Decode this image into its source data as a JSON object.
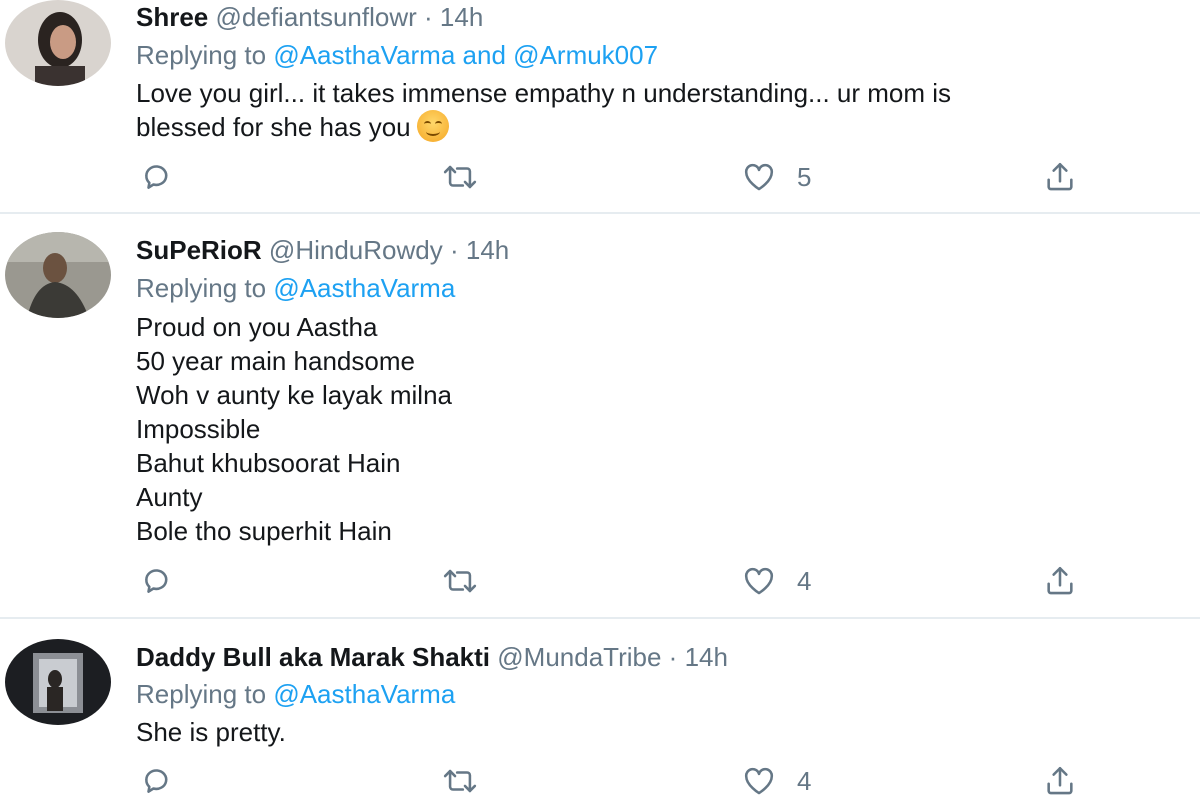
{
  "tweets": [
    {
      "name": "Shree",
      "handle": "@defiantsunflowr",
      "dot": "·",
      "time": "14h",
      "reply_prefix": "Replying to",
      "mention1": "@AasthaVarma",
      "and": "and",
      "mention2": "@Armuk007",
      "body": "Love you girl... it takes immense empathy n understanding... ur mom is\nblessed for she has you",
      "like_count": "5"
    },
    {
      "name": "SuPeRioR",
      "handle": "@HinduRowdy",
      "dot": "·",
      "time": "14h",
      "reply_prefix": "Replying to",
      "mention1": "@AasthaVarma",
      "body": "Proud on you Aastha\n50 year main handsome\nWoh v aunty ke layak milna\nImpossible\nBahut khubsoorat Hain\nAunty\nBole tho superhit Hain",
      "like_count": "4"
    },
    {
      "name": "Daddy Bull aka Marak Shakti",
      "handle": "@MundaTribe",
      "dot": "·",
      "time": "14h",
      "reply_prefix": "Replying to",
      "mention1": "@AasthaVarma",
      "body": "She is pretty.",
      "like_count": "4"
    }
  ],
  "icons": {
    "reply": "reply-icon",
    "retweet": "retweet-icon",
    "like": "heart-icon",
    "share": "share-icon"
  },
  "colors": {
    "secondary_text": "#657786",
    "link": "#1da1f2",
    "divider": "#e6ecf0"
  }
}
